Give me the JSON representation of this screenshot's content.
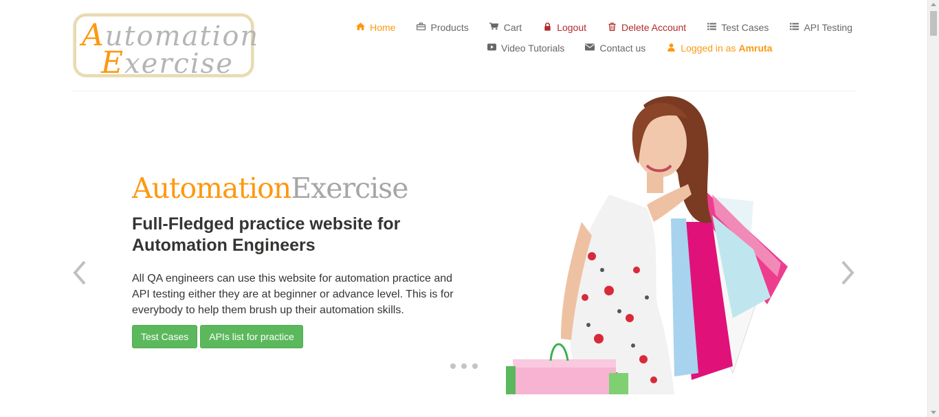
{
  "logo": {
    "line1_cap": "A",
    "line1_rest": "utomation",
    "line2_cap": "E",
    "line2_rest": "xercise"
  },
  "nav": {
    "row1": [
      {
        "label": "Home",
        "icon": "home-icon"
      },
      {
        "label": "Products",
        "icon": "briefcase-icon"
      },
      {
        "label": "Cart",
        "icon": "cart-icon"
      },
      {
        "label": "Logout",
        "icon": "lock-icon"
      },
      {
        "label": "Delete Account",
        "icon": "trash-icon"
      },
      {
        "label": "Test Cases",
        "icon": "list-icon"
      },
      {
        "label": "API Testing",
        "icon": "list-icon"
      }
    ],
    "row2": [
      {
        "label": "Video Tutorials",
        "icon": "youtube-play-icon"
      },
      {
        "label": "Contact us",
        "icon": "envelope-icon"
      }
    ],
    "logged_in_prefix": "Logged in as",
    "logged_in_user": "Amruta"
  },
  "hero": {
    "title_part1": "Automation",
    "title_part2": "Exercise",
    "subtitle": "Full-Fledged practice website for Automation Engineers",
    "description": "All QA engineers can use this website for automation practice and API testing either they are at beginner or advance level. This is for everybody to help them brush up their automation skills.",
    "button_test_cases": "Test Cases",
    "button_apis": "APIs list for practice",
    "image": "woman-with-shopping-bags",
    "slide_count": 3
  },
  "colors": {
    "accent": "#fe980f",
    "danger": "#b12b2b",
    "button": "#5cb85c",
    "text": "#696763"
  }
}
